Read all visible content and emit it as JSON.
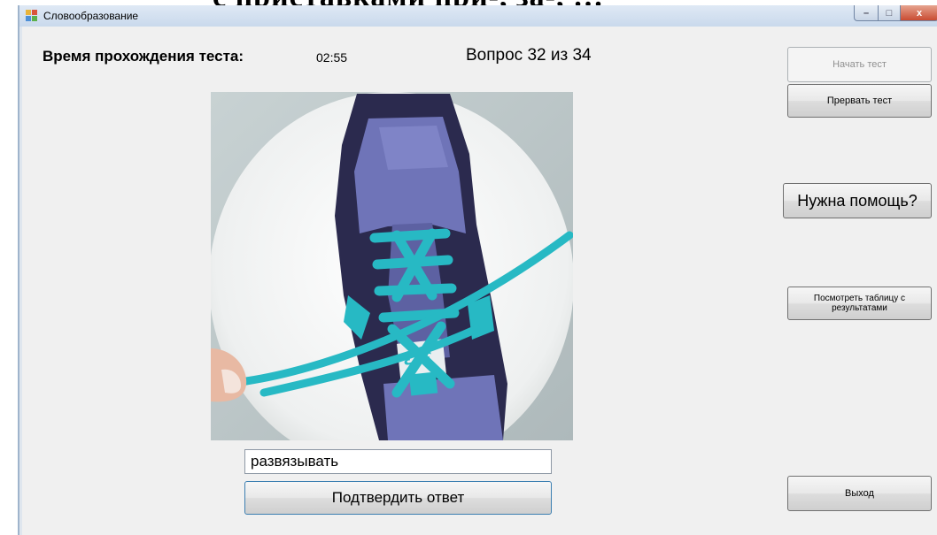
{
  "overlay_heading": "с приставками при-, за-, …",
  "window": {
    "title": "Словообразование",
    "controls": {
      "minimize": "–",
      "maximize": "□",
      "close": "x"
    }
  },
  "test": {
    "time_label": "Время прохождения теста:",
    "time_value": "02:55",
    "question_counter": "Вопрос 32 из 34"
  },
  "answer": {
    "value": "развязывать",
    "confirm_label": "Подтвердить ответ"
  },
  "side_buttons": {
    "start": "Начать тест",
    "stop": "Прервать тест",
    "help": "Нужна помощь?",
    "results": "Посмотреть таблицу с результатами",
    "exit": "Выход"
  },
  "colors": {
    "accent_lace": "#27b9c4",
    "shoe_body": "#6f74b8",
    "close_button": "#c94b32"
  }
}
